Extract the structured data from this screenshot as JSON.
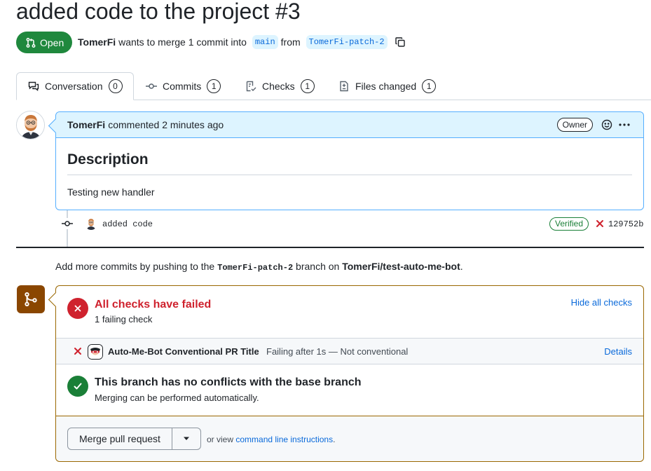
{
  "pr": {
    "title": "added code to the project #3",
    "state": "Open",
    "author": "TomerFi",
    "merge_text": "wants to merge 1 commit into",
    "base_branch": "main",
    "from_text": "from",
    "head_branch": "TomerFi-patch-2"
  },
  "tabs": [
    {
      "label": "Conversation",
      "count": "0",
      "icon": "comment-discussion-icon"
    },
    {
      "label": "Commits",
      "count": "1",
      "icon": "git-commit-icon"
    },
    {
      "label": "Checks",
      "count": "1",
      "icon": "checklist-icon"
    },
    {
      "label": "Files changed",
      "count": "1",
      "icon": "file-diff-icon"
    }
  ],
  "comment": {
    "author": "TomerFi",
    "action": "commented 2 minutes ago",
    "badge": "Owner",
    "heading": "Description",
    "body": "Testing new handler"
  },
  "commit": {
    "message": "added code",
    "verified": "Verified",
    "sha": "129752b"
  },
  "push_hint": {
    "prefix": "Add more commits by pushing to the",
    "branch": "TomerFi-patch-2",
    "middle": "branch on",
    "repo": "TomerFi/test-auto-me-bot",
    "suffix": "."
  },
  "checks": {
    "title": "All checks have failed",
    "subtitle": "1 failing check",
    "hide_label": "Hide all checks",
    "items": [
      {
        "name": "Auto-Me-Bot Conventional PR Title",
        "description": "Failing after 1s — Not conventional",
        "details": "Details"
      }
    ]
  },
  "conflicts": {
    "title": "This branch has no conflicts with the base branch",
    "subtitle": "Merging can be performed automatically."
  },
  "merge": {
    "button": "Merge pull request",
    "alt_prefix": "or view",
    "alt_link": "command line instructions",
    "alt_suffix": "."
  },
  "colors": {
    "open_green": "#1f883d",
    "fail_red": "#cf222e",
    "success_green": "#1a7f37",
    "link_blue": "#0969da",
    "merge_brown": "#8a4600"
  }
}
